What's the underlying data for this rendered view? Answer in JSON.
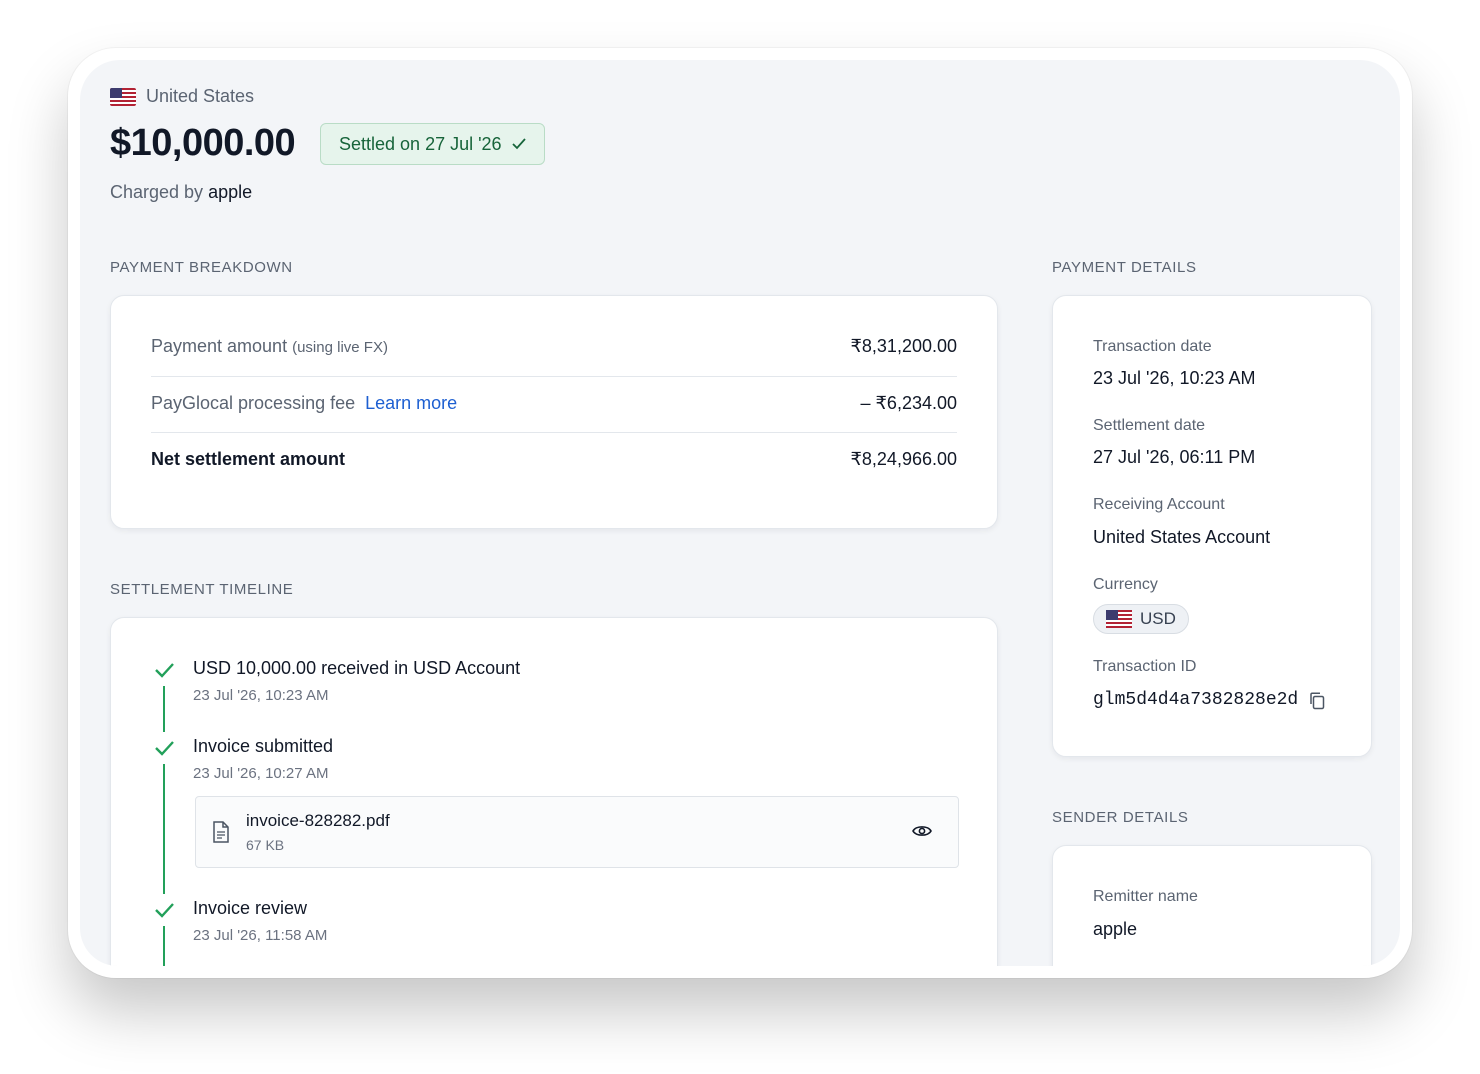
{
  "header": {
    "country": "United States",
    "amount": "$10,000.00",
    "status_badge": "Settled on 27 Jul '26",
    "charged_by_prefix": "Charged by",
    "charged_by_name": "apple"
  },
  "breakdown": {
    "section_title": "PAYMENT BREAKDOWN",
    "rows": [
      {
        "label": "Payment amount",
        "note": "(using live FX)",
        "value": "₹8,31,200.00"
      },
      {
        "label": "PayGlocal processing fee",
        "link": "Learn more",
        "value": "– ₹6,234.00"
      },
      {
        "label": "Net settlement amount",
        "value": "₹8,24,966.00"
      }
    ]
  },
  "timeline": {
    "section_title": "SETTLEMENT TIMELINE",
    "events": [
      {
        "title": "USD 10,000.00 received in USD Account",
        "time": "23 Jul '26, 10:23 AM"
      },
      {
        "title": "Invoice submitted",
        "time": "23 Jul '26, 10:27 AM"
      },
      {
        "title": "Invoice review",
        "time": "23 Jul '26, 11:58 AM"
      }
    ],
    "attachment": {
      "name": "invoice-828282.pdf",
      "size": "67 KB"
    }
  },
  "payment_details": {
    "section_title": "PAYMENT DETAILS",
    "transaction_date_label": "Transaction date",
    "transaction_date": "23 Jul '26, 10:23 AM",
    "settlement_date_label": "Settlement date",
    "settlement_date": "27 Jul '26, 06:11 PM",
    "receiving_account_label": "Receiving Account",
    "receiving_account": "United States Account",
    "currency_label": "Currency",
    "currency": "USD",
    "transaction_id_label": "Transaction ID",
    "transaction_id": "glm5d4d4a7382828e2d"
  },
  "sender_details": {
    "section_title": "SENDER DETAILS",
    "remitter_name_label": "Remitter name",
    "remitter_name": "apple"
  },
  "colors": {
    "success": "#22a05a",
    "badge_bg": "#e6f4ec",
    "link": "#1d5fd1"
  }
}
